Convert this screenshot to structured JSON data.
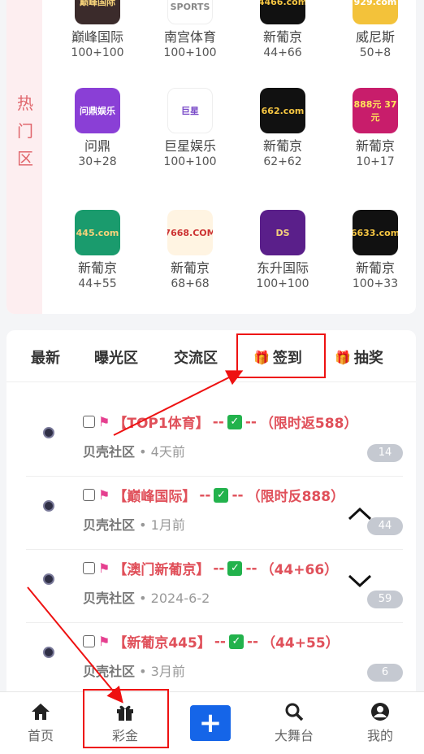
{
  "hot_zone": {
    "side_label": "热门区",
    "apps": [
      {
        "name": "巅峰国际",
        "odds": "100+100",
        "icon_text": "巅峰国际",
        "bg": "#3b2b2b",
        "fg": "#f5d27a"
      },
      {
        "name": "南宫体育",
        "odds": "100+100",
        "icon_text": "NG SPORTS",
        "bg": "#ffffff",
        "fg": "#888888"
      },
      {
        "name": "新葡京",
        "odds": "44+66",
        "icon_text": "4466.com",
        "bg": "#111111",
        "fg": "#f5c542"
      },
      {
        "name": "威尼斯",
        "odds": "50+8",
        "icon_text": "929.com",
        "bg": "#f3c23a",
        "fg": "#ffffff"
      },
      {
        "name": "问鼎",
        "odds": "30+28",
        "icon_text": "问鼎娱乐",
        "bg": "#8a3fd6",
        "fg": "#ffffff"
      },
      {
        "name": "巨星娱乐",
        "odds": "100+100",
        "icon_text": "巨星",
        "bg": "#ffffff",
        "fg": "#7a4bc8"
      },
      {
        "name": "新葡京",
        "odds": "62+62",
        "icon_text": "662.com",
        "bg": "#111111",
        "fg": "#f5c542"
      },
      {
        "name": "新葡京",
        "odds": "10+17",
        "icon_text": "888元 37元",
        "bg": "#c81d6b",
        "fg": "#ffe45a"
      },
      {
        "name": "新葡京",
        "odds": "44+55",
        "icon_text": "445.com",
        "bg": "#1a9b6d",
        "fg": "#f5d27a"
      },
      {
        "name": "新葡京",
        "odds": "68+68",
        "icon_text": "7668.COM",
        "bg": "#fff4e2",
        "fg": "#c33"
      },
      {
        "name": "东升国际",
        "odds": "100+100",
        "icon_text": "DS",
        "bg": "#5a1f8a",
        "fg": "#f5d27a"
      },
      {
        "name": "新葡京",
        "odds": "100+33",
        "icon_text": "6633.com",
        "bg": "#111111",
        "fg": "#f5c542"
      }
    ]
  },
  "tabs": [
    {
      "label": "最新",
      "gift": false
    },
    {
      "label": "曝光区",
      "gift": false
    },
    {
      "label": "交流区",
      "gift": false
    },
    {
      "label": "签到",
      "gift": true
    },
    {
      "label": "抽奖",
      "gift": true
    }
  ],
  "posts": [
    {
      "name": "【TOP1体育】",
      "dash1": "--",
      "dash2": "--",
      "suffix": "（限时返588）",
      "author": "贝壳社区",
      "time": "4天前",
      "count": "14"
    },
    {
      "name": "【巅峰国际】",
      "dash1": "--",
      "dash2": "--",
      "suffix": "（限时反888）",
      "author": "贝壳社区",
      "time": "1月前",
      "count": "44"
    },
    {
      "name": "【澳门新葡京】",
      "dash1": "--",
      "dash2": "--",
      "suffix": "（44+66）",
      "author": "贝壳社区",
      "time": "2024-6-2",
      "count": "59"
    },
    {
      "name": "【新葡京445】",
      "dash1": "--",
      "dash2": "--",
      "suffix": "（44+55）",
      "author": "贝壳社区",
      "time": "3月前",
      "count": "6"
    }
  ],
  "ok_mark": "✓",
  "meta_sep": "•",
  "nav": [
    {
      "label": "首页",
      "icon": "home-icon"
    },
    {
      "label": "彩金",
      "icon": "gift-icon"
    },
    {
      "label": "",
      "icon": "plus-icon"
    },
    {
      "label": "大舞台",
      "icon": "search-icon"
    },
    {
      "label": "我的",
      "icon": "user-icon"
    }
  ],
  "plus_symbol": "+",
  "colors": {
    "accent_red": "#e0505a",
    "nav_blue": "#1565e8",
    "annotation_red": "#e11111"
  }
}
